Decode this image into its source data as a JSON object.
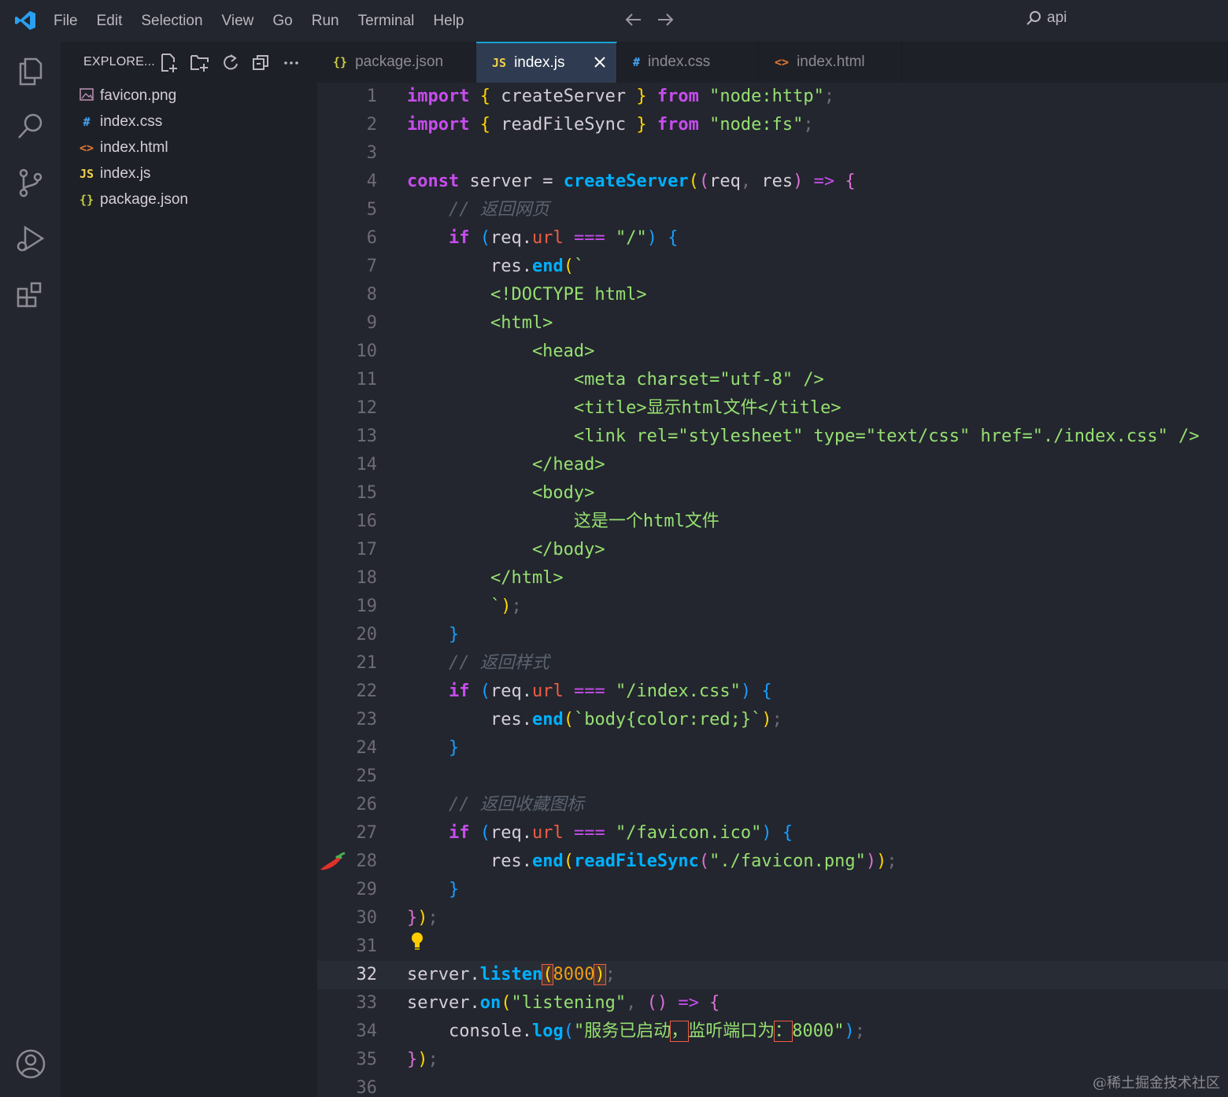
{
  "menu": [
    "File",
    "Edit",
    "Selection",
    "View",
    "Go",
    "Run",
    "Terminal",
    "Help"
  ],
  "command_center": "api",
  "sidebar": {
    "title": "EXPLORE...",
    "files": [
      {
        "name": "favicon.png",
        "icon": "image-icon",
        "glyph": "",
        "color": "#b48ead"
      },
      {
        "name": "index.css",
        "icon": "hash-icon",
        "glyph": "#",
        "color": "#42a5f5"
      },
      {
        "name": "index.html",
        "icon": "code-brackets-icon",
        "glyph": "<>",
        "color": "#e37933"
      },
      {
        "name": "index.js",
        "icon": "js-icon",
        "glyph": "JS",
        "color": "#f1d24a"
      },
      {
        "name": "package.json",
        "icon": "braces-icon",
        "glyph": "{}",
        "color": "#cbcb41"
      }
    ]
  },
  "tabs": [
    {
      "label": "package.json",
      "glyph": "{}",
      "color": "#cbcb41",
      "width": 202,
      "active": false
    },
    {
      "label": "index.js",
      "glyph": "JS",
      "color": "#f1d24a",
      "width": 179,
      "active": true
    },
    {
      "label": "index.css",
      "glyph": "#",
      "color": "#42a5f5",
      "width": 180,
      "active": false
    },
    {
      "label": "index.html",
      "glyph": "<>",
      "color": "#e37933",
      "width": 182,
      "active": false
    }
  ],
  "code_lines": [
    "import { createServer } from \"node:http\";",
    "import { readFileSync } from \"node:fs\";",
    "",
    "const server = createServer((req, res) => {",
    "    // 返回网页",
    "    if (req.url === \"/\") {",
    "        res.end(`",
    "        <!DOCTYPE html>",
    "        <html>",
    "            <head>",
    "                <meta charset=\"utf-8\" />",
    "                <title>显示html文件</title>",
    "                <link rel=\"stylesheet\" type=\"text/css\" href=\"./index.css\" />",
    "            </head>",
    "            <body>",
    "                这是一个html文件",
    "            </body>",
    "        </html>",
    "        `);",
    "    }",
    "    // 返回样式",
    "    if (req.url === \"/index.css\") {",
    "        res.end(`body{color:red;}`);",
    "    }",
    "",
    "    // 返回收藏图标",
    "    if (req.url === \"/favicon.ico\") {",
    "        res.end(readFileSync(\"./favicon.png\"));",
    "    }",
    "});",
    "",
    "server.listen(8000);",
    "server.on(\"listening\", () => {",
    "    console.log(\"服务已启动，监听端口为：8000\");",
    "});",
    ""
  ],
  "current_line": 32,
  "watermark": "@稀土掘金技术社区"
}
